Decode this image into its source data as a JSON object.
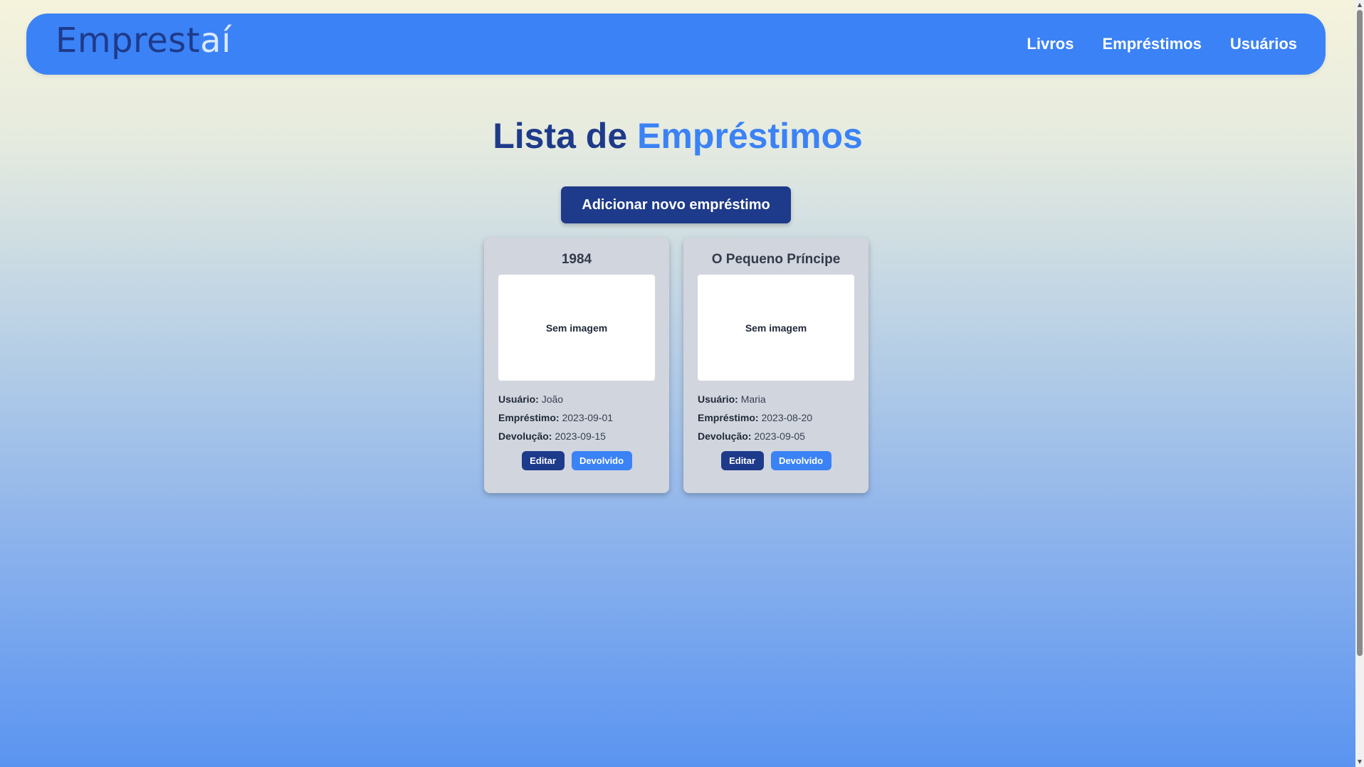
{
  "header": {
    "logo_dark": "Emprest",
    "logo_light": "aí",
    "nav": [
      "Livros",
      "Empréstimos",
      "Usuários"
    ]
  },
  "page": {
    "title_part1": "Lista de ",
    "title_part2": "Empréstimos",
    "add_button": "Adicionar novo empréstimo"
  },
  "labels": {
    "no_image": "Sem imagem",
    "user": "Usuário:",
    "loan": "Empréstimo:",
    "return": "Devolução:",
    "edit": "Editar",
    "returned": "Devolvido"
  },
  "loans": [
    {
      "book": "1984",
      "user": "João",
      "loan_date": "2023-09-01",
      "return_date": "2023-09-15"
    },
    {
      "book": "O Pequeno Príncipe",
      "user": "Maria",
      "loan_date": "2023-08-20",
      "return_date": "2023-09-05"
    }
  ],
  "colors": {
    "primary": "#3b82f6",
    "dark_primary": "#1e3a8a",
    "card_bg": "#d1d5de"
  }
}
